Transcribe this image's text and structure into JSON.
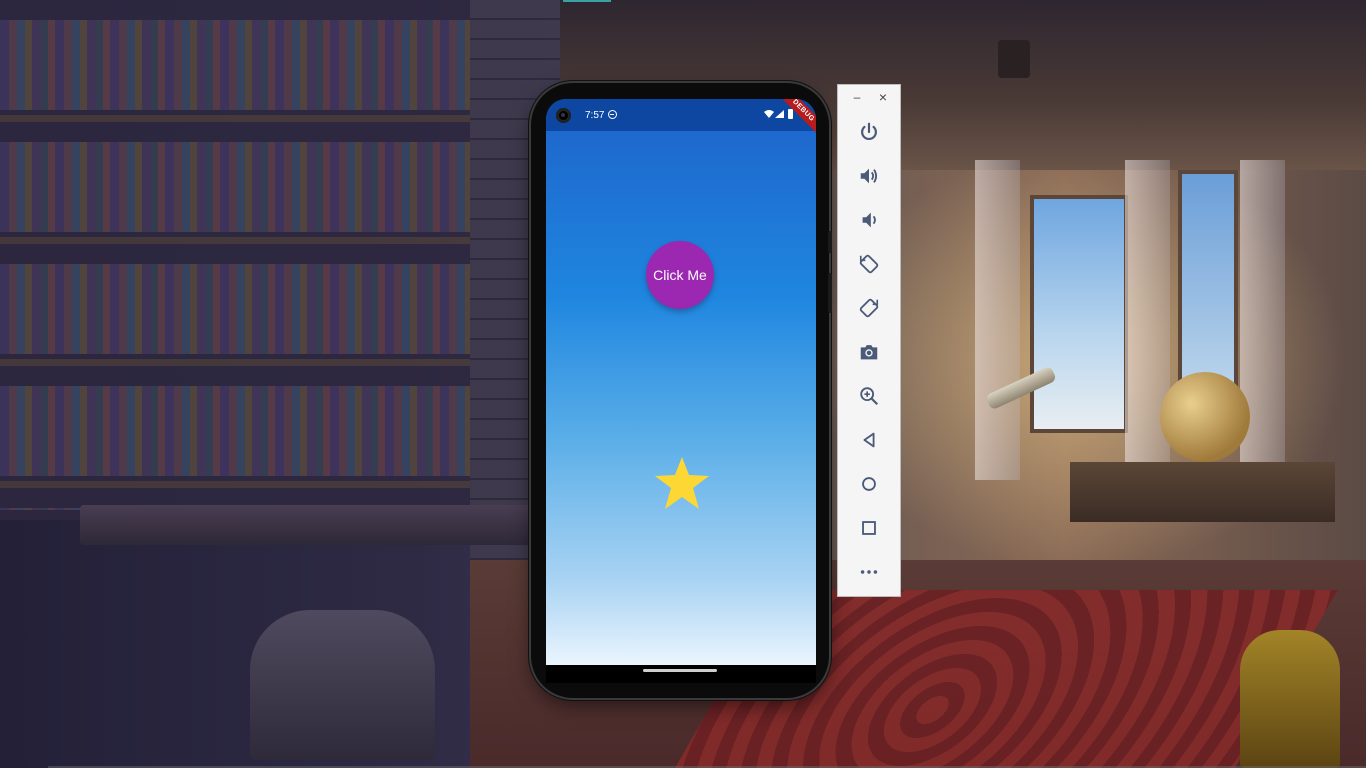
{
  "wallpaper": {
    "name": "fantasy-library-room"
  },
  "phone": {
    "status_bar": {
      "time": "7:57",
      "debug_banner": "DEBUG"
    },
    "app": {
      "button_label": "Click Me",
      "button_color": "#9c27b0",
      "star_color": "#fdd835",
      "background_top": "#1e63c9",
      "background_bottom": "#eaf5fd"
    }
  },
  "emulator_toolbar": {
    "window_controls": [
      "minimize",
      "close"
    ],
    "items": [
      {
        "icon": "power-icon",
        "action": "power"
      },
      {
        "icon": "volume-up-icon",
        "action": "volume-up"
      },
      {
        "icon": "volume-down-icon",
        "action": "volume-down"
      },
      {
        "icon": "rotate-left-icon",
        "action": "rotate-left"
      },
      {
        "icon": "rotate-right-icon",
        "action": "rotate-right"
      },
      {
        "icon": "camera-icon",
        "action": "screenshot"
      },
      {
        "icon": "zoom-in-icon",
        "action": "zoom"
      },
      {
        "icon": "back-icon",
        "action": "back"
      },
      {
        "icon": "home-icon",
        "action": "home"
      },
      {
        "icon": "overview-icon",
        "action": "overview"
      },
      {
        "icon": "more-icon",
        "action": "more"
      }
    ]
  }
}
